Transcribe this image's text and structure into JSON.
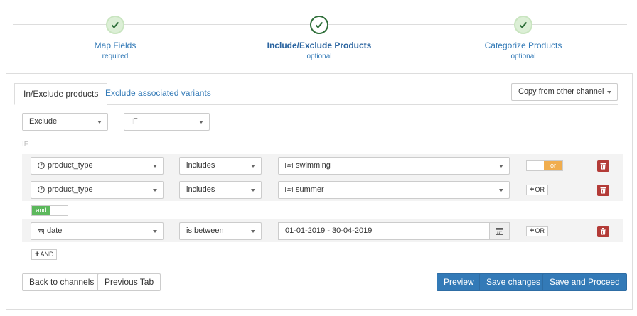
{
  "steps": [
    {
      "name": "Map Fields",
      "sub": "required"
    },
    {
      "name": "Include/Exclude Products",
      "sub": "optional"
    },
    {
      "name": "Categorize Products",
      "sub": "optional"
    }
  ],
  "tabs": {
    "active": "In/Exclude products",
    "other": "Exclude associated variants"
  },
  "copy_select": "Copy from other channel",
  "mode_select": "Exclude",
  "if_select": "IF",
  "if_label": "IF",
  "rules": [
    {
      "field": "product_type",
      "operator": "includes",
      "value": "swimming"
    },
    {
      "field": "product_type",
      "operator": "includes",
      "value": "summer"
    }
  ],
  "or_toggle": "or",
  "and_toggle": "and",
  "date_rule": {
    "field": "date",
    "operator": "is between",
    "value": "01-01-2019 - 30-04-2019"
  },
  "or_button": "OR",
  "and_button": "AND",
  "footer": {
    "back": "Back to channels",
    "previous": "Previous Tab",
    "preview": "Preview",
    "save": "Save changes",
    "save_proceed": "Save and Proceed"
  },
  "colors": {
    "primary": "#337ab7",
    "danger": "#b33b37",
    "or": "#f0ad4e",
    "and": "#5cb85c"
  }
}
